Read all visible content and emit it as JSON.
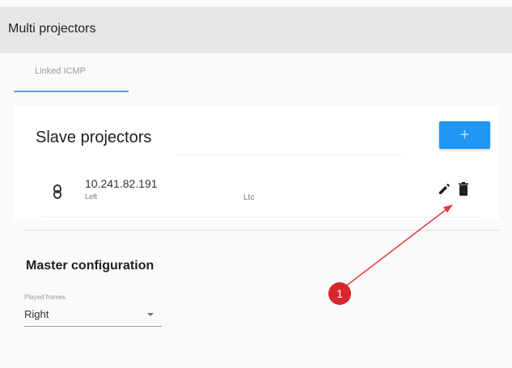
{
  "header": {
    "title": "Multi projectors"
  },
  "tabs": [
    {
      "label": "Linked ICMP",
      "active": true
    }
  ],
  "slave_section": {
    "title": "Slave projectors",
    "add_button_label": "+",
    "projectors": [
      {
        "ip": "10.241.82.191",
        "position": "Left",
        "mode": "Ltc"
      }
    ]
  },
  "master_section": {
    "title": "Master configuration",
    "field_label": "Played frames",
    "field_value": "Right"
  },
  "callout": {
    "number": "1",
    "color": "#d7262d"
  },
  "colors": {
    "accent": "#2196f3",
    "tab_underline": "#5aa0d6"
  }
}
